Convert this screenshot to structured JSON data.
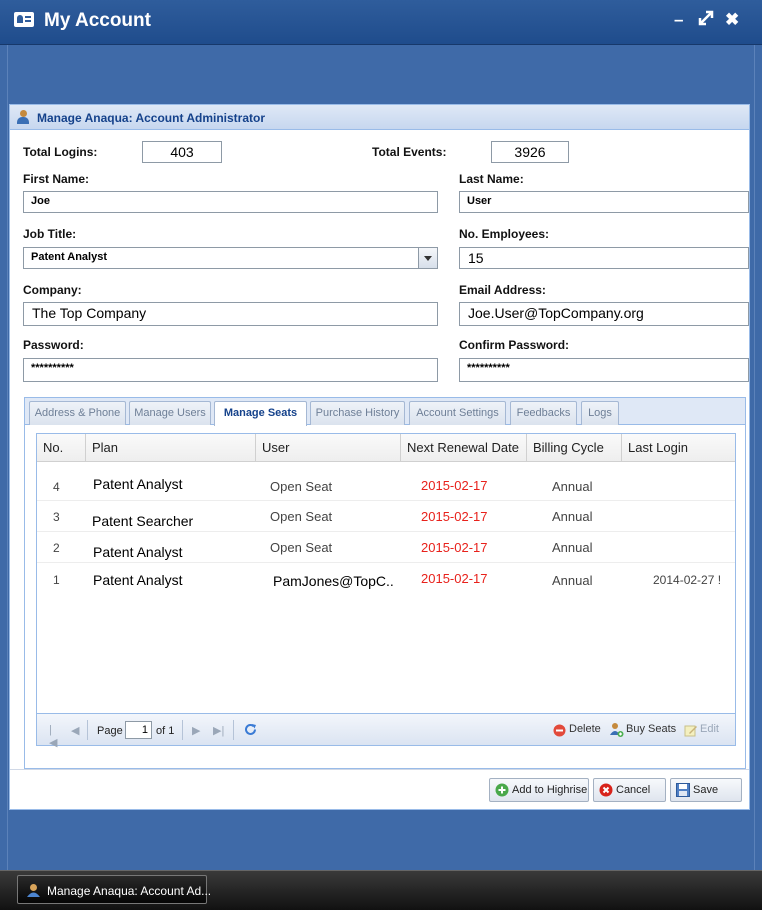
{
  "window": {
    "title": "My Account",
    "icon": "account-card-icon"
  },
  "dialog": {
    "title": "Manage Anaqua: Account Administrator",
    "stats": {
      "total_logins_label": "Total Logins:",
      "total_logins": "403",
      "total_events_label": "Total Events:",
      "total_events": "3926"
    },
    "fields": {
      "first_name": {
        "label": "First Name:",
        "value": "Joe"
      },
      "last_name": {
        "label": "Last Name:",
        "value": "User"
      },
      "job_title": {
        "label": "Job Title:",
        "value": "Patent Analyst"
      },
      "employees": {
        "label": "No. Employees:",
        "value": "15"
      },
      "company": {
        "label": "Company:",
        "value": "The Top Company"
      },
      "email": {
        "label": "Email Address:",
        "value": "Joe.User@TopCompany.org"
      },
      "password": {
        "label": "Password:",
        "value": "**********"
      },
      "confirm_password": {
        "label": "Confirm Password:",
        "value": "**********"
      }
    },
    "tabs": [
      {
        "label": "Address & Phone"
      },
      {
        "label": "Manage Users"
      },
      {
        "label": "Manage Seats",
        "active": true
      },
      {
        "label": "Purchase History"
      },
      {
        "label": "Account Settings"
      },
      {
        "label": "Feedbacks"
      },
      {
        "label": "Logs"
      }
    ],
    "grid": {
      "columns": [
        "No.",
        "Plan",
        "User",
        "Next Renewal Date",
        "Billing Cycle",
        "Last Login"
      ],
      "rows": [
        {
          "no": "4",
          "plan": "Patent Analyst",
          "user": "Open Seat",
          "renewal": "2015-02-17",
          "cycle": "Annual",
          "last_login": ""
        },
        {
          "no": "3",
          "plan": "Patent Searcher",
          "user": "Open Seat",
          "renewal": "2015-02-17",
          "cycle": "Annual",
          "last_login": ""
        },
        {
          "no": "2",
          "plan": "Patent Analyst",
          "user": "Open Seat",
          "renewal": "2015-02-17",
          "cycle": "Annual",
          "last_login": ""
        },
        {
          "no": "1",
          "plan": "Patent Analyst",
          "user": "PamJones@TopC..",
          "renewal": "2015-02-17",
          "cycle": "Annual",
          "last_login": "2014-02-27 !"
        }
      ],
      "renewal_color": "#e8211b"
    },
    "pager": {
      "page_label": "Page",
      "page": "1",
      "of_label": "of 1"
    },
    "grid_toolbar": {
      "delete": "Delete",
      "buy_seats": "Buy Seats",
      "edit": "Edit"
    },
    "footer": {
      "add_highrise": "Add to Highrise",
      "cancel": "Cancel",
      "save": "Save"
    }
  },
  "taskbar": {
    "item_label": "Manage Anaqua: Account Ad..."
  },
  "colors": {
    "window_blue": "#3f6aa8",
    "header_text": "#15428b",
    "accent_red": "#e8211b"
  }
}
